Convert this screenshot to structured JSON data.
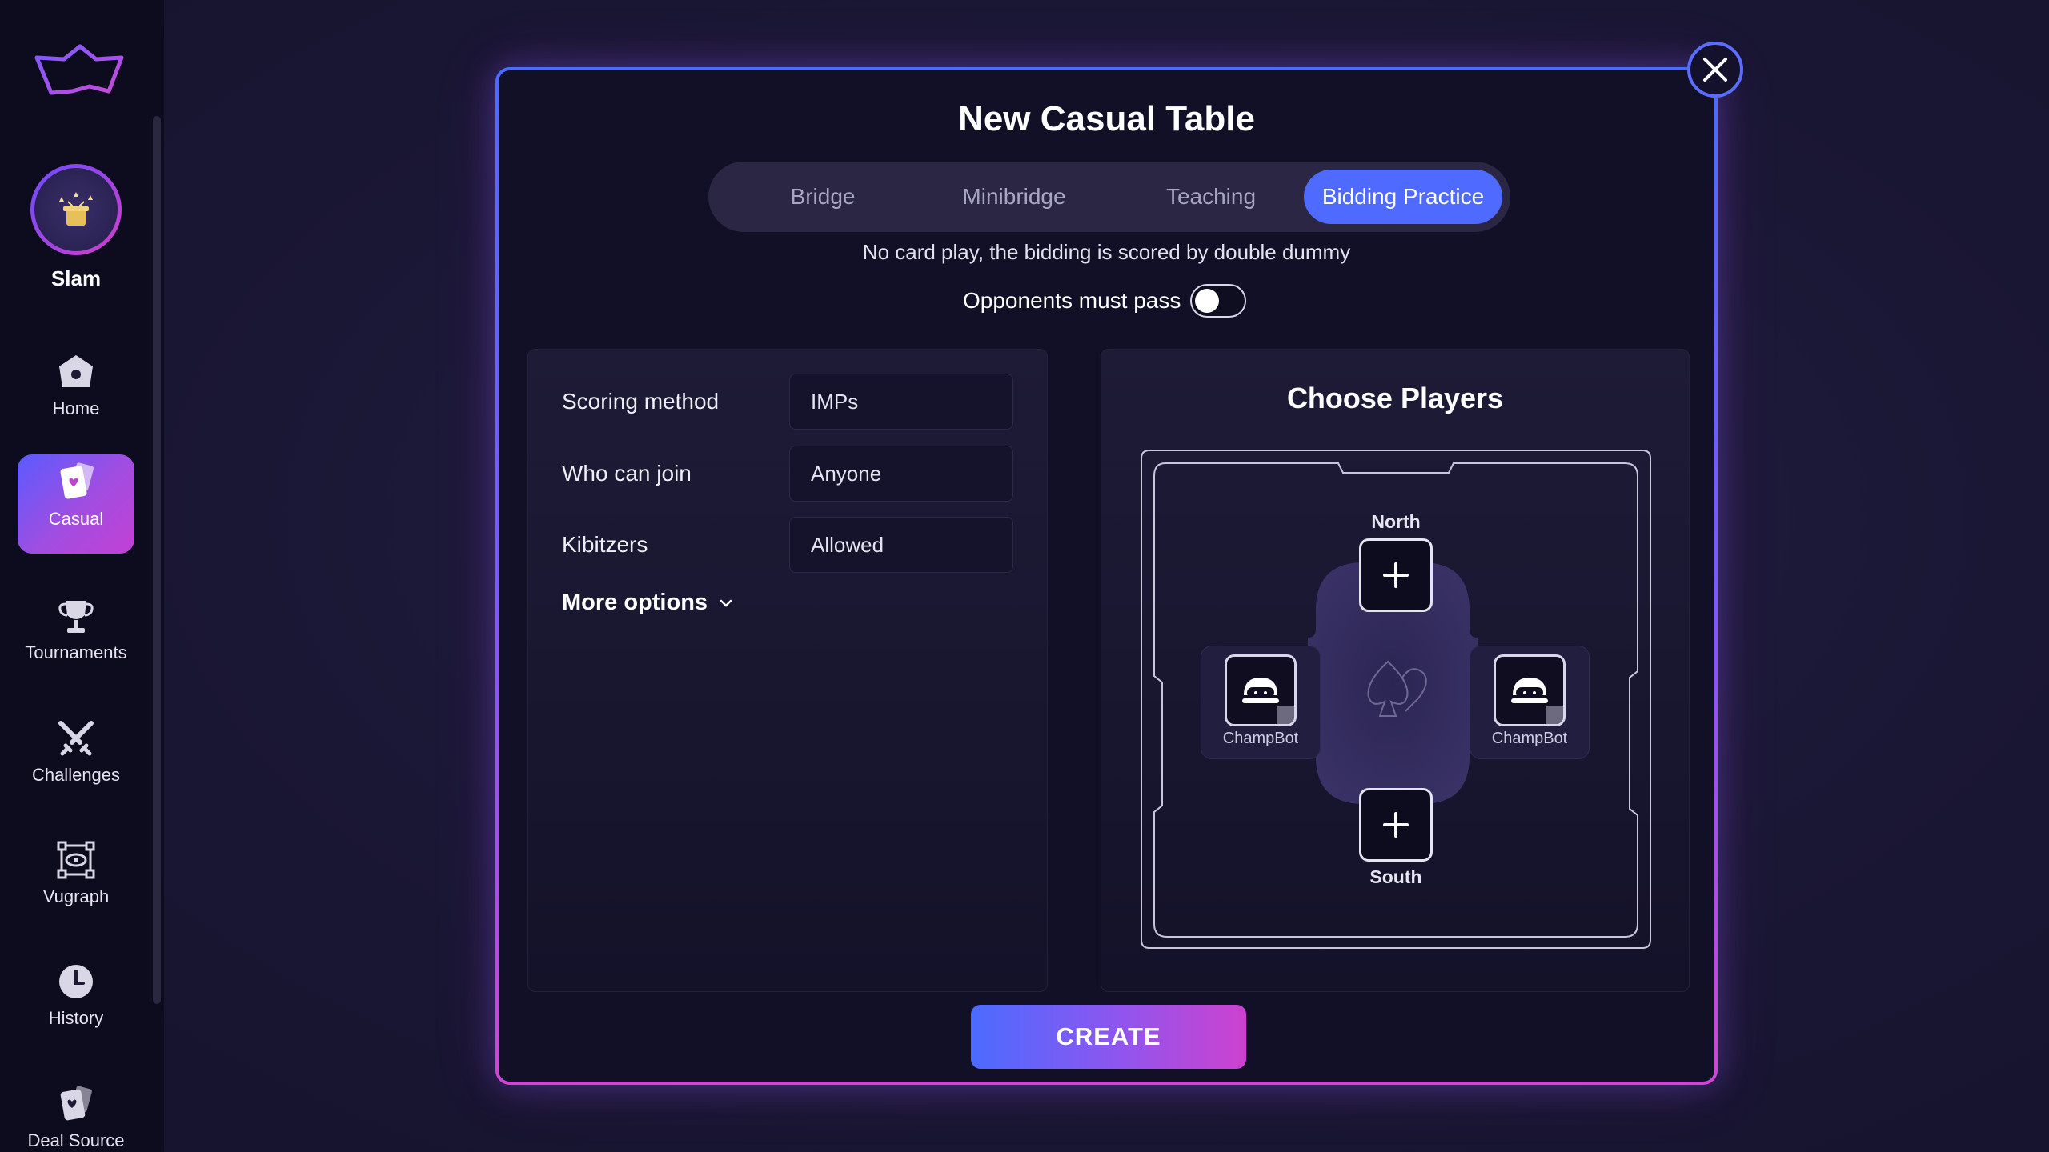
{
  "sidebar": {
    "profile_label": "Slam",
    "items": [
      {
        "label": "Home",
        "icon": "home-icon"
      },
      {
        "label": "Casual",
        "icon": "cards-icon"
      },
      {
        "label": "Tournaments",
        "icon": "trophy-icon"
      },
      {
        "label": "Challenges",
        "icon": "crossed-swords-icon"
      },
      {
        "label": "Vugraph",
        "icon": "vugraph-eye-icon"
      },
      {
        "label": "History",
        "icon": "clock-icon"
      },
      {
        "label": "Deal Source",
        "icon": "deal-cards-icon"
      }
    ],
    "active_item": "Casual"
  },
  "modal": {
    "title": "New Casual Table",
    "tabs": [
      "Bridge",
      "Minibridge",
      "Teaching",
      "Bidding Practice"
    ],
    "active_tab": "Bidding Practice",
    "description": "No card play, the bidding is scored by double dummy",
    "toggle": {
      "label": "Opponents must pass",
      "on": false
    },
    "settings": [
      {
        "label": "Scoring method",
        "value": "IMPs"
      },
      {
        "label": "Who can join",
        "value": "Anyone"
      },
      {
        "label": "Kibitzers",
        "value": "Allowed"
      }
    ],
    "more_options": "More options",
    "players": {
      "title": "Choose Players",
      "north_label": "North",
      "south_label": "South",
      "west_bot": "ChampBot",
      "east_bot": "ChampBot"
    },
    "create_label": "CREATE"
  },
  "colors": {
    "accent_blue": "#4f6bff",
    "accent_pink": "#cd42cf",
    "background": "#1b1838",
    "sidebar": "#0d0b1e"
  }
}
